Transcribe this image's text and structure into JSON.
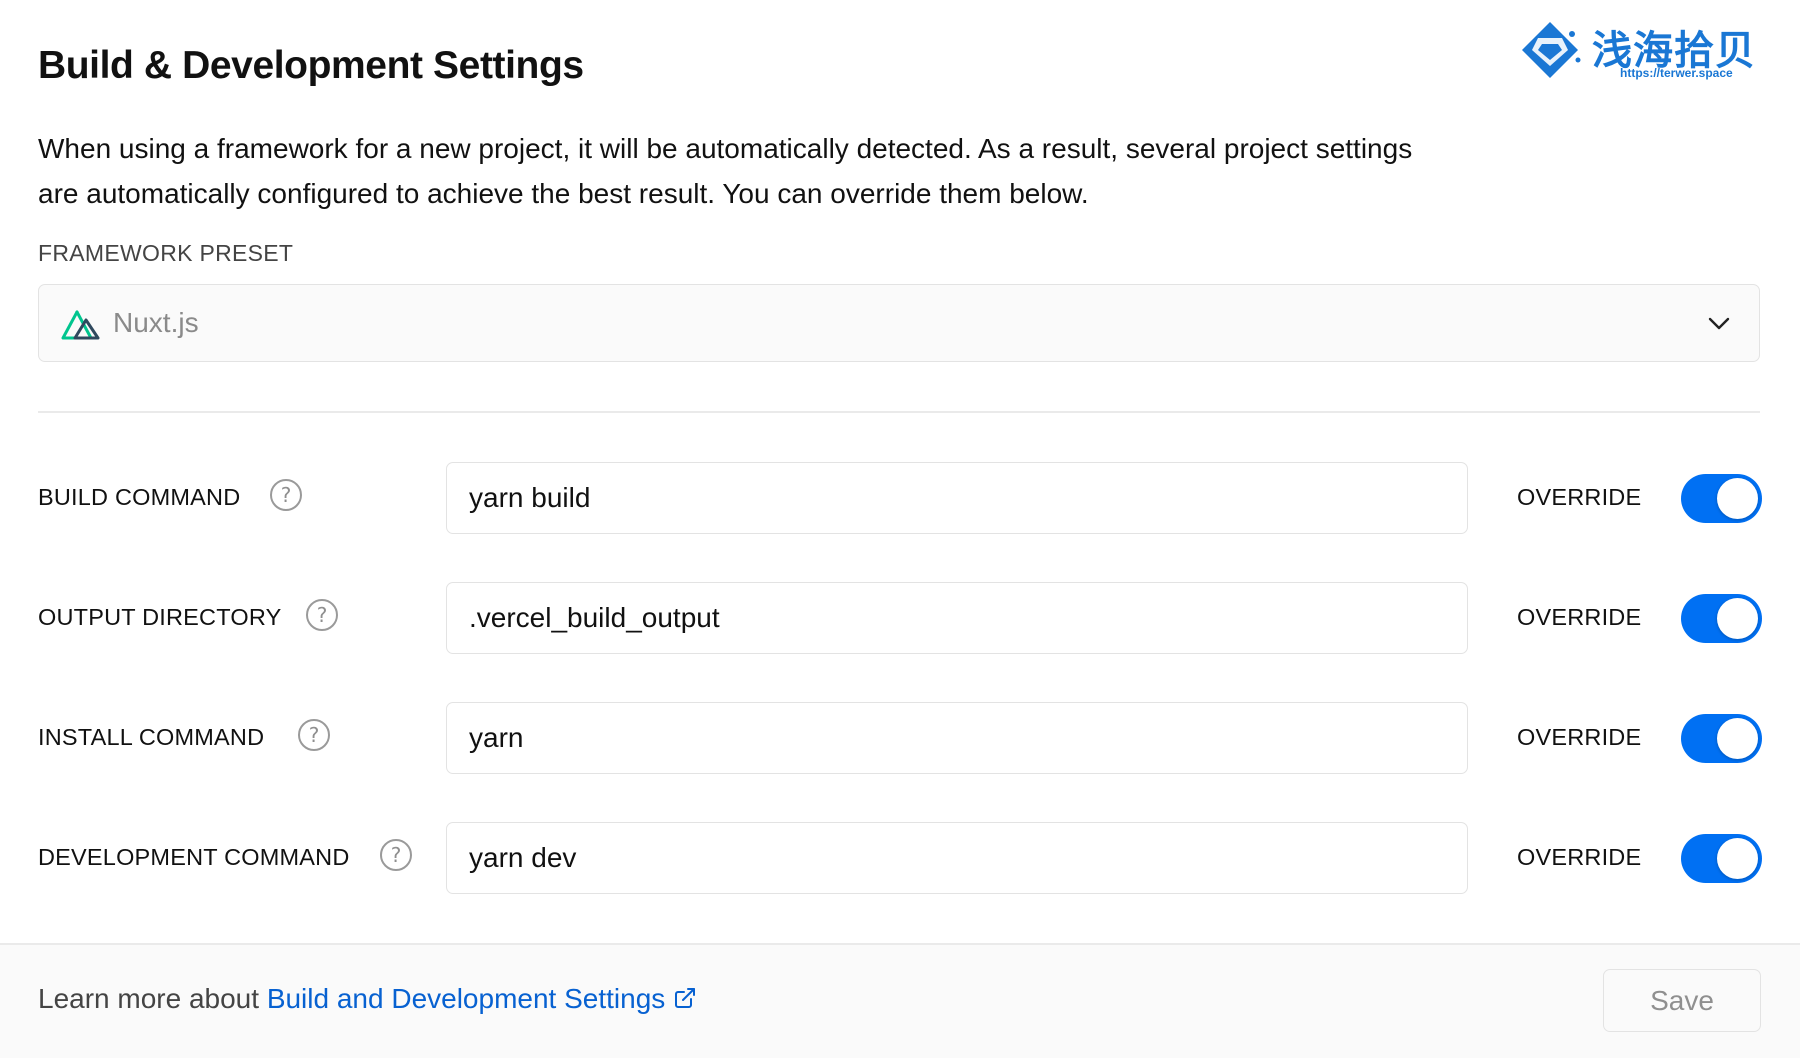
{
  "header": {
    "title": "Build & Development Settings",
    "description": "When using a framework for a new project, it will be automatically detected. As a result, several project settings are automatically configured to achieve the best result. You can override them below."
  },
  "framework_preset": {
    "label": "FRAMEWORK PRESET",
    "selected": "Nuxt.js",
    "icon": "nuxt-logo-icon"
  },
  "settings": [
    {
      "label": "BUILD COMMAND",
      "value": "yarn build",
      "override_label": "OVERRIDE",
      "override_enabled": true
    },
    {
      "label": "OUTPUT DIRECTORY",
      "value": ".vercel_build_output",
      "override_label": "OVERRIDE",
      "override_enabled": true
    },
    {
      "label": "INSTALL COMMAND",
      "value": "yarn",
      "override_label": "OVERRIDE",
      "override_enabled": true
    },
    {
      "label": "DEVELOPMENT COMMAND",
      "value": "yarn dev",
      "override_label": "OVERRIDE",
      "override_enabled": true
    }
  ],
  "footer": {
    "prefix": "Learn more about ",
    "link_text": "Build and Development Settings",
    "save_label": "Save"
  },
  "watermark": {
    "title": "浅海拾贝",
    "url": "https://terwer.space"
  },
  "colors": {
    "accent": "#0070f3",
    "link": "#0761d1",
    "nuxt_green": "#00c58e",
    "nuxt_dark": "#2f495e",
    "watermark": "#1a77d4"
  }
}
